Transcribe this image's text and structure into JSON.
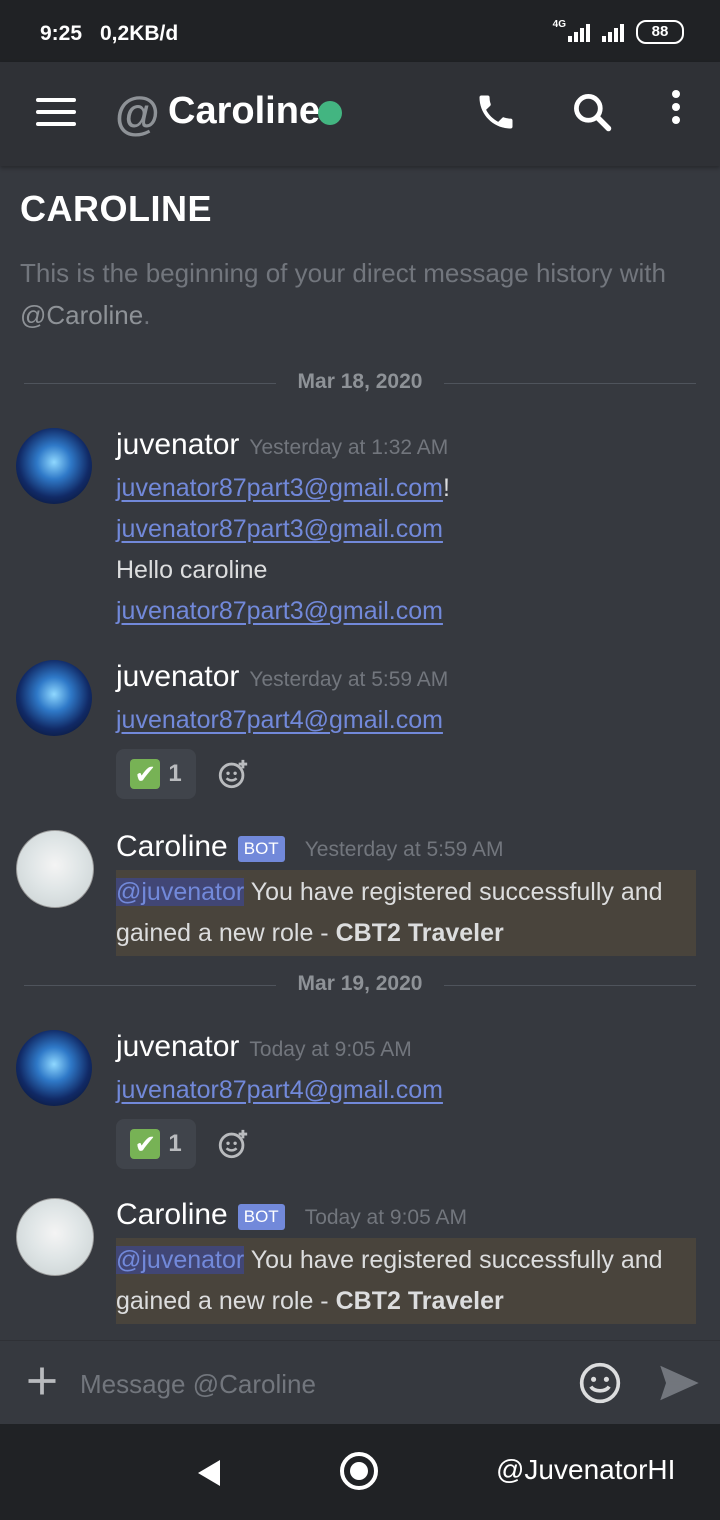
{
  "status_bar": {
    "time": "9:25",
    "net_speed": "0,2KB/d",
    "network_type": "4G",
    "battery": "88"
  },
  "header": {
    "title": "Caroline",
    "at_symbol": "@",
    "status_color": "#43b581"
  },
  "intro": {
    "title": "CAROLINE",
    "description_part1": "This is the beginning of your direct message history with ",
    "description_handle": "@Caroline",
    "description_end": "."
  },
  "dividers": [
    "Mar 18, 2020",
    "Mar 19, 2020"
  ],
  "messages": [
    {
      "author": "juvenator",
      "timestamp": "Yesterday at 1:32 AM",
      "lines": [
        {
          "link": "juvenator87part3@gmail.com",
          "suffix": "!"
        },
        {
          "link": "juvenator87part3@gmail.com"
        },
        {
          "text": "Hello caroline"
        },
        {
          "link": "juvenator87part3@gmail.com"
        }
      ]
    },
    {
      "author": "juvenator",
      "timestamp": "Yesterday at 5:59 AM",
      "lines": [
        {
          "link": "juvenator87part4@gmail.com"
        }
      ],
      "reaction": {
        "emoji": "✔",
        "count": "1"
      }
    },
    {
      "author": "Caroline",
      "bot_badge": "BOT",
      "timestamp": "Yesterday at 5:59 AM",
      "mention": "@juvenator",
      "text1": " You have registered successfully and",
      "text2": "gained a new role - ",
      "role": "CBT2 Traveler"
    },
    {
      "author": "juvenator",
      "timestamp": "Today at 9:05 AM",
      "lines": [
        {
          "link": "juvenator87part4@gmail.com"
        }
      ],
      "reaction": {
        "emoji": "✔",
        "count": "1"
      }
    },
    {
      "author": "Caroline",
      "bot_badge": "BOT",
      "timestamp": "Today at 9:05 AM",
      "mention": "@juvenator",
      "text1": " You have registered successfully and",
      "text2": "gained a new role - ",
      "role": "CBT2 Traveler"
    }
  ],
  "composer": {
    "placeholder": "Message @Caroline"
  },
  "nav": {
    "watermark": "@JuvenatorHI"
  }
}
